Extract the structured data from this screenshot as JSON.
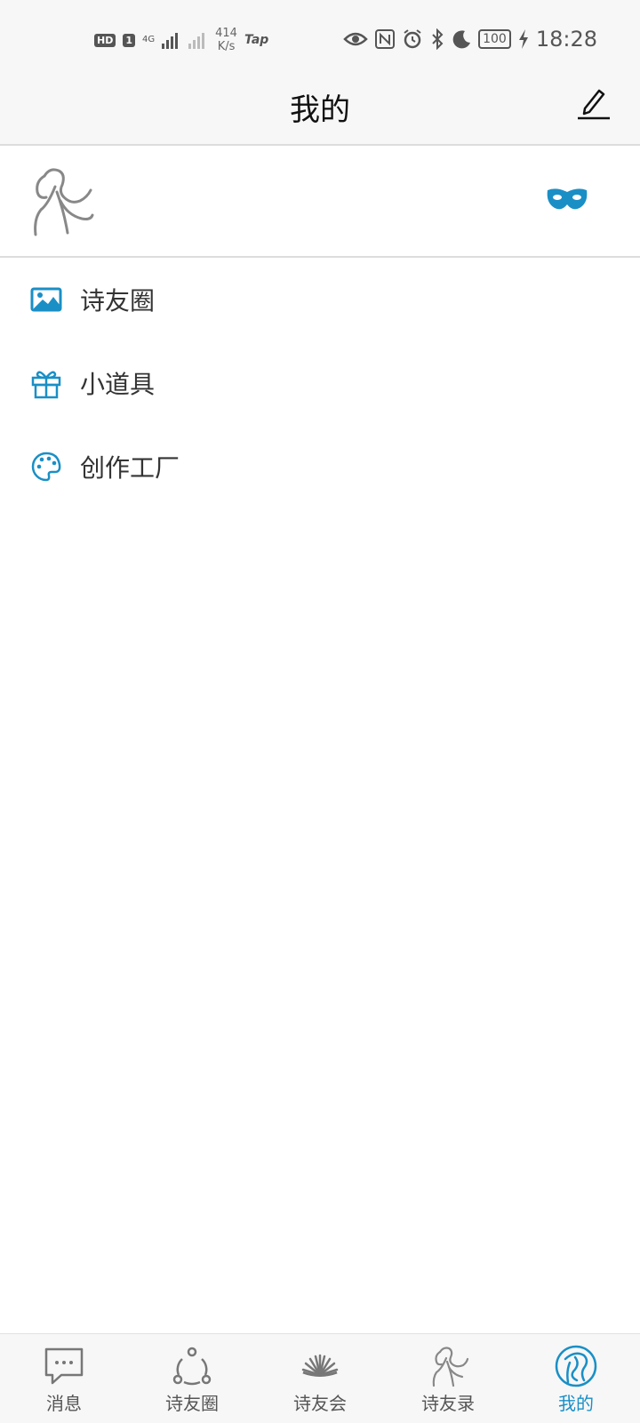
{
  "status_bar": {
    "hd_label": "HD",
    "sim_label": "1",
    "network_label": "4G",
    "speed_value": "414",
    "speed_unit": "K/s",
    "app_label": "Tap",
    "battery_label": "100",
    "time": "18:28"
  },
  "header": {
    "title": "我的"
  },
  "menu": {
    "items": [
      {
        "label": "诗友圈",
        "icon": "image-icon"
      },
      {
        "label": "小道具",
        "icon": "gift-icon"
      },
      {
        "label": "创作工厂",
        "icon": "palette-icon"
      }
    ]
  },
  "tabs": {
    "items": [
      {
        "label": "消息",
        "icon": "chat-icon"
      },
      {
        "label": "诗友圈",
        "icon": "circle-nodes-icon"
      },
      {
        "label": "诗友会",
        "icon": "fan-icon"
      },
      {
        "label": "诗友录",
        "icon": "figure-icon"
      },
      {
        "label": "我的",
        "icon": "profile-icon"
      }
    ],
    "active_index": 4
  },
  "colors": {
    "accent": "#1a8fc6",
    "bar_background": "#f7f7f7",
    "divider": "#dddddd"
  }
}
